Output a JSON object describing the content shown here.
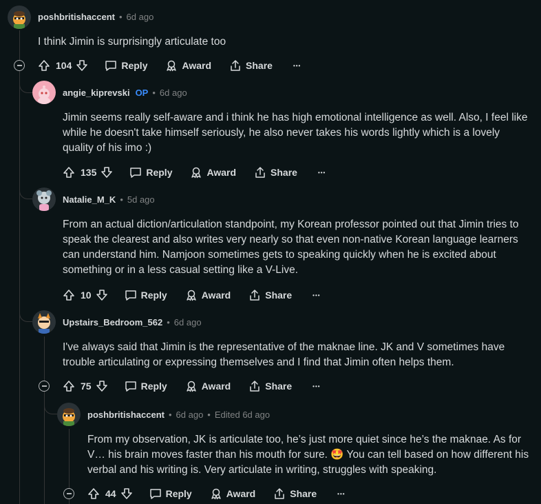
{
  "comments": [
    {
      "author": "poshbritishaccent",
      "op": "",
      "time": "6d ago",
      "edited": "",
      "body": "I think Jimin is surprisingly articulate too",
      "votes": "104",
      "reply": "Reply",
      "award": "Award",
      "share": "Share",
      "more": "•••"
    },
    {
      "author": "angie_kiprevski",
      "op": "OP",
      "time": "6d ago",
      "edited": "",
      "body": "Jimin seems really self-aware and i think he has high emotional intelligence as well. Also, I feel like while he doesn't take himself seriously, he also never takes his words lightly which is a lovely quality of his imo :)",
      "votes": "135",
      "reply": "Reply",
      "award": "Award",
      "share": "Share",
      "more": "•••"
    },
    {
      "author": "Natalie_M_K",
      "op": "",
      "time": "5d ago",
      "edited": "",
      "body": "From an actual diction/articulation standpoint, my Korean professor pointed out that Jimin tries to speak the clearest and also writes very nearly so that even non-native Korean language learners can understand him. Namjoon sometimes gets to speaking quickly when he is excited about something or in a less casual setting like a V-Live.",
      "votes": "10",
      "reply": "Reply",
      "award": "Award",
      "share": "Share",
      "more": "•••"
    },
    {
      "author": "Upstairs_Bedroom_562",
      "op": "",
      "time": "6d ago",
      "edited": "",
      "body": "I've always said that Jimin is the representative of the maknae line. JK and V sometimes have trouble articulating or expressing themselves and I find that Jimin often helps them.",
      "votes": "75",
      "reply": "Reply",
      "award": "Award",
      "share": "Share",
      "more": "•••"
    },
    {
      "author": "poshbritishaccent",
      "op": "",
      "time": "6d ago",
      "edited": "Edited 6d ago",
      "body": "From my observation, JK is articulate too, he’s just more quiet since he’s the maknae. As for V… his brain moves faster than his mouth for sure. 🤩 You can tell based on how different his verbal and his writing is. Very articulate in writing, struggles with speaking.",
      "votes": "44",
      "reply": "Reply",
      "award": "Award",
      "share": "Share",
      "more": "•••"
    }
  ],
  "separator": "•",
  "icons": {
    "upvote": "arrow-up-icon",
    "downvote": "arrow-down-icon",
    "reply": "speech-bubble-icon",
    "award": "award-ribbon-icon",
    "share": "share-upload-icon",
    "collapse": "minus-circle-icon"
  },
  "colors": {
    "background": "#0b1416",
    "text": "#d7dadc",
    "muted": "#818384",
    "op": "#3a8dff",
    "thread": "#343536"
  }
}
